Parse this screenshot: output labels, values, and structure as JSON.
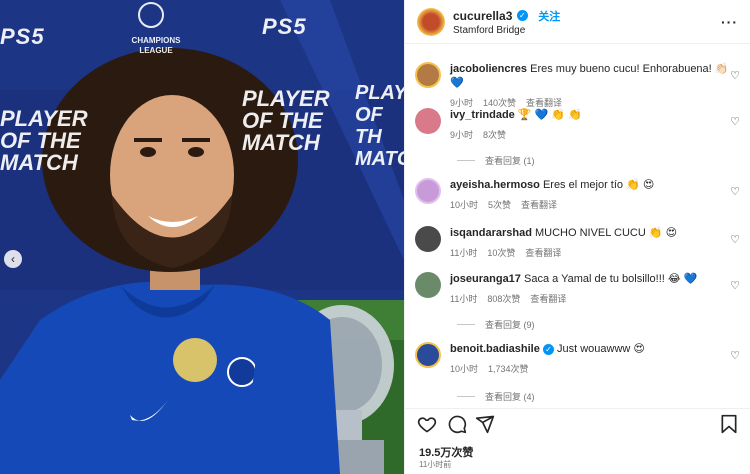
{
  "post": {
    "username": "cucurella3",
    "location": "Stamford Bridge",
    "follow_label": "关注",
    "likes": "19.5万次赞",
    "time_ago": "11小时前"
  },
  "media": {
    "sponsor_text": "PS5",
    "competition": "CHAMPIONS LEAGUE",
    "award_line1": "PLAYER",
    "award_line2": "OF THE",
    "award_line3": "MATCH"
  },
  "comments": [
    {
      "user": "jacoboliencres",
      "text": "Eres muy bueno cucu! Enhorabuena! 👏🏻 💙",
      "time": "9小时",
      "likes": "140次赞",
      "translate": "查看翻译",
      "avatar_color": "#b47a45"
    },
    {
      "user": "ivy_trindade",
      "text": "🏆 💙 👏 👏",
      "time": "9小时",
      "likes": "8次赞",
      "translate": "",
      "avatar_color": "#d87a8a",
      "replies": "查看回复 (1)"
    },
    {
      "user": "ayeisha.hermoso",
      "text": "Eres el mejor tío 👏 😍",
      "time": "10小时",
      "likes": "5次赞",
      "translate": "查看翻译",
      "avatar_color": "#c89ad8"
    },
    {
      "user": "isqandararshad",
      "text": "MUCHO NIVEL CUCU 👏 😍",
      "time": "11小时",
      "likes": "10次赞",
      "translate": "查看翻译",
      "avatar_color": "#4a4a4a"
    },
    {
      "user": "joseuranga17",
      "text": "Saca a Yamal de tu bolsillo!!! 😂 💙",
      "time": "11小时",
      "likes": "808次赞",
      "translate": "查看翻译",
      "avatar_color": "#6a8a6a",
      "replies": "查看回复 (9)"
    },
    {
      "user": "benoit.badiashile",
      "text": "Just wouawww 😍",
      "time": "10小时",
      "likes": "1,734次赞",
      "translate": "",
      "avatar_color": "#2a4a9a",
      "replies": "查看回复 (4)",
      "verified": true
    }
  ],
  "icons": {
    "like": "heart-icon",
    "comment": "comment-icon",
    "share": "share-icon",
    "save": "bookmark-icon",
    "prev": "chevron-left-icon",
    "more": "more-icon"
  },
  "colors": {
    "accent": "#0095f6",
    "muted": "#737373",
    "media_bg": "#1d2f7a"
  }
}
